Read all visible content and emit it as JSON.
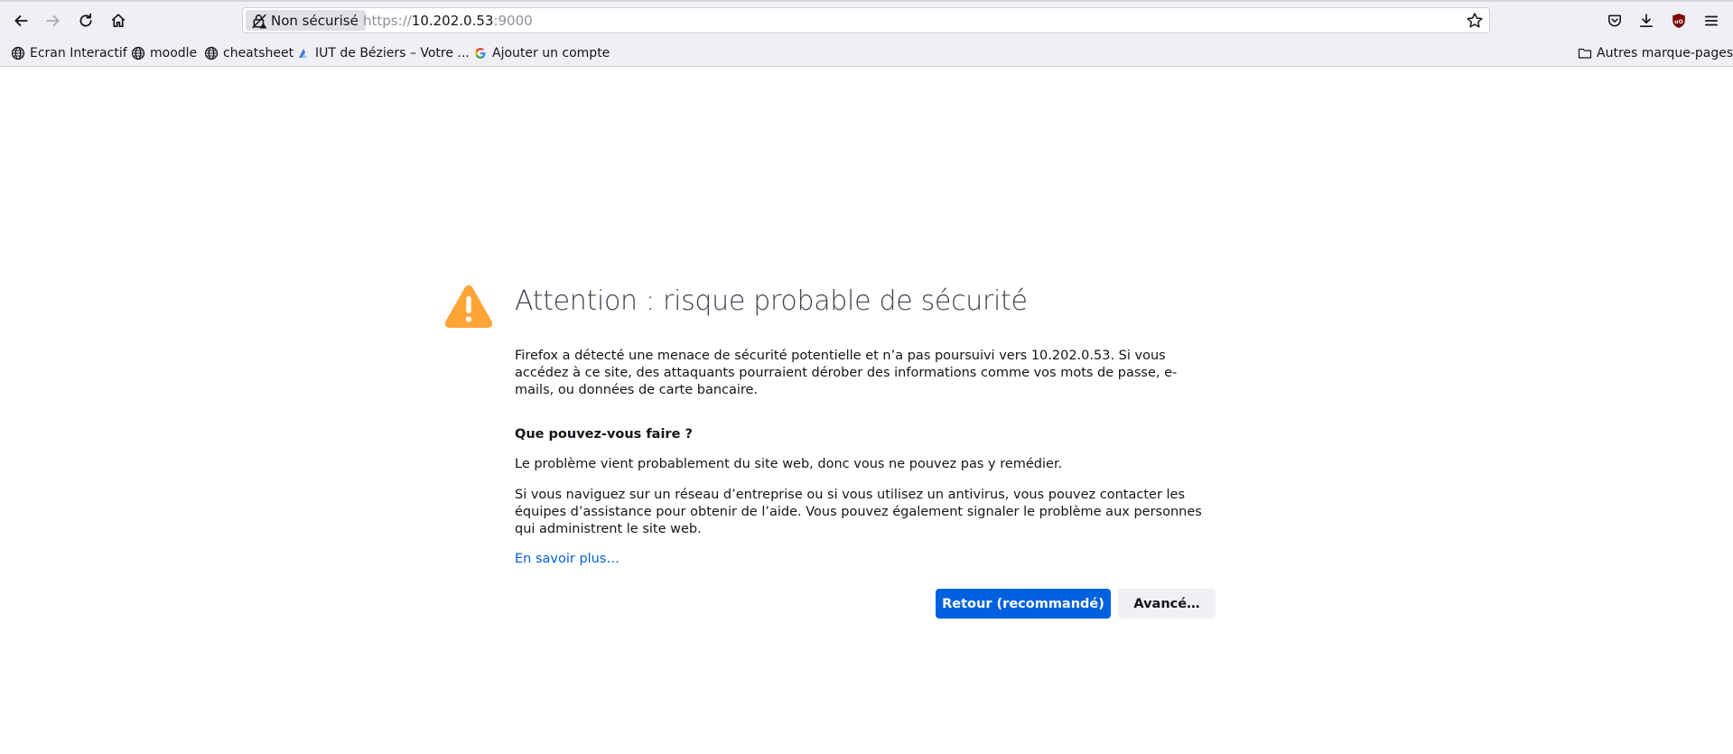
{
  "toolbar": {
    "back_icon": "arrow-left-icon",
    "forward_icon": "arrow-right-icon",
    "reload_icon": "reload-icon",
    "home_icon": "home-icon",
    "identity_label": "Non sécurisé",
    "url_scheme": "https://",
    "url_host": "10.202.0.53",
    "url_port": ":9000",
    "pocket_icon": "pocket-icon",
    "downloads_icon": "download-icon",
    "ublock_icon": "ublock-origin-icon",
    "menu_icon": "hamburger-menu-icon"
  },
  "bookmarks": {
    "items": [
      {
        "label": "Ecran Interactif",
        "icon": "globe-icon"
      },
      {
        "label": "moodle",
        "icon": "globe-icon"
      },
      {
        "label": "cheatsheet",
        "icon": "globe-icon"
      },
      {
        "label": "IUT de Béziers – Votre ...",
        "icon": "iut-favicon"
      },
      {
        "label": "Ajouter un compte",
        "icon": "google-g-icon"
      }
    ],
    "other_label": "Autres marque-pages"
  },
  "error_page": {
    "title": "Attention : risque probable de sécurité",
    "intro": "Firefox a détecté une menace de sécurité potentielle et n’a pas poursuivi vers 10.202.0.53. Si vous accédez à ce site, des attaquants pourraient dérober des informations comme vos mots de passe, e-mails, ou données de carte bancaire.",
    "what_heading": "Que pouvez-vous faire ?",
    "what_1": "Le problème vient probablement du site web, donc vous ne pouvez pas y remédier.",
    "what_2": "Si vous naviguez sur un réseau d’entreprise ou si vous utilisez un antivirus, vous pouvez contacter les équipes d’assistance pour obtenir de l’aide. Vous pouvez également signaler le problème aux personnes qui administrent le site web.",
    "learn_more": "En savoir plus…",
    "back_button": "Retour (recommandé)",
    "advanced_button": "Avancé…"
  },
  "colors": {
    "accent": "#0061e0",
    "warning": "#ffa436",
    "link": "#0060df"
  }
}
